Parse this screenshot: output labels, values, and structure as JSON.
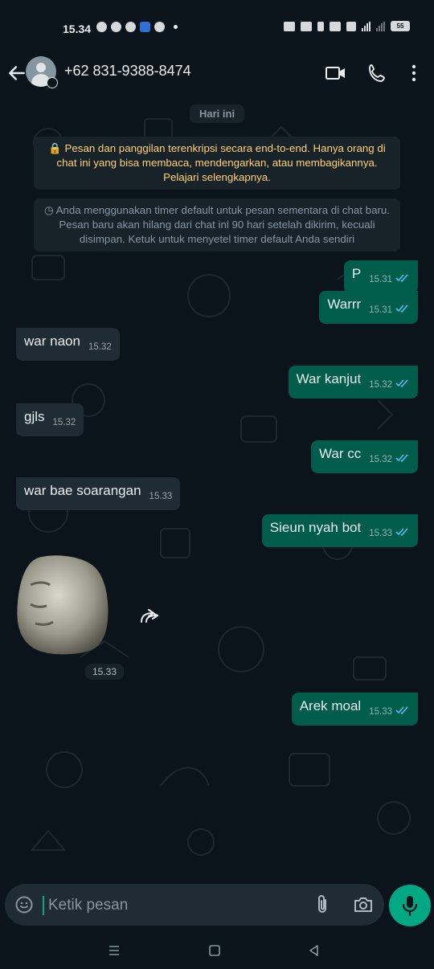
{
  "status_bar": {
    "time": "15.34",
    "battery": "55"
  },
  "header": {
    "contact_name": "+62 831-9388-8474"
  },
  "chat": {
    "date_chip": "Hari ini",
    "encryption_notice": "🔒 Pesan dan panggilan terenkripsi secara end-to-end. Hanya orang di chat ini yang bisa membaca, mendengarkan, atau membagikannya. Pelajari selengkapnya.",
    "timer_notice": "◷ Anda menggunakan timer default untuk pesan sementara di chat baru. Pesan baru akan hilang dari chat ini 90 hari setelah dikirim, kecuali disimpan. Ketuk untuk menyetel timer default Anda sendiri",
    "messages": [
      {
        "dir": "out",
        "text": "P",
        "time": "15.31"
      },
      {
        "dir": "out",
        "text": "Warrr",
        "time": "15.31"
      },
      {
        "dir": "in",
        "text": "war naon",
        "time": "15.32"
      },
      {
        "dir": "out",
        "text": "War kanjut",
        "time": "15.32"
      },
      {
        "dir": "in",
        "text": "gjls",
        "time": "15.32"
      },
      {
        "dir": "out",
        "text": "War cc",
        "time": "15.32"
      },
      {
        "dir": "in",
        "text": "war bae soarangan",
        "time": "15.33"
      },
      {
        "dir": "out",
        "text": "Sieun nyah bot",
        "time": "15.33"
      },
      {
        "dir": "out",
        "text": "Arek moal",
        "time": "15.33"
      }
    ],
    "sticker_time": "15.33"
  },
  "input": {
    "placeholder": "Ketik pesan"
  },
  "colors": {
    "background": "#0b141a",
    "outgoing_bubble": "#005c4b",
    "incoming_bubble": "#202c33",
    "accent": "#00a884",
    "read_ticks": "#53bdeb"
  }
}
